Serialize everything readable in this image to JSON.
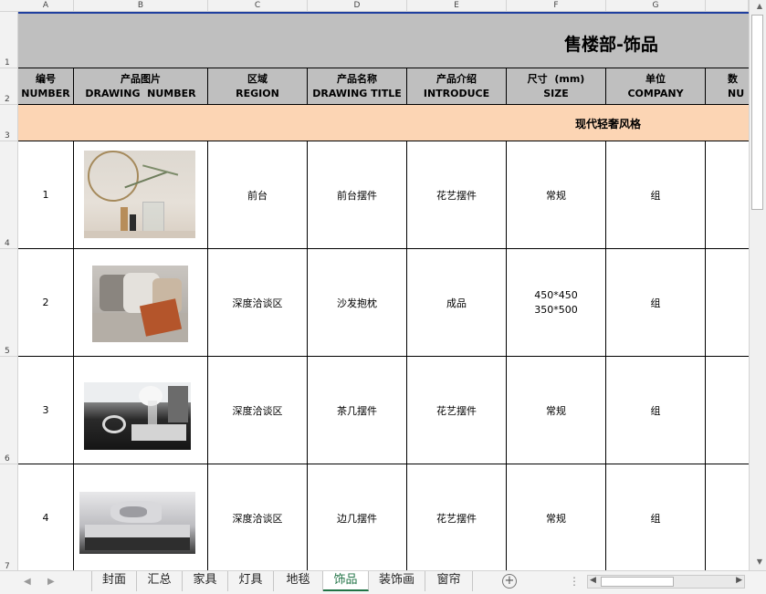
{
  "columns": [
    "A",
    "B",
    "C",
    "D",
    "E",
    "F",
    "G"
  ],
  "rows": [
    "1",
    "2",
    "3",
    "4",
    "5",
    "6",
    "7"
  ],
  "sheet_title": "售楼部-饰品",
  "headers": [
    {
      "cn": "编号",
      "en": "NUMBER"
    },
    {
      "cn": "产品图片",
      "en": "DRAWING  NUMBER"
    },
    {
      "cn": "区域",
      "en": "REGION"
    },
    {
      "cn": "产品名称",
      "en": "DRAWING TITLE"
    },
    {
      "cn": "产品介绍",
      "en": "INTRODUCE"
    },
    {
      "cn": "尺寸  (mm)",
      "en": "SIZE"
    },
    {
      "cn": "单位",
      "en": "COMPANY"
    },
    {
      "cn": "数",
      "en": "NU"
    }
  ],
  "style_label": "现代轻奢风格",
  "items": [
    {
      "number": "1",
      "region": "前台",
      "title": "前台摆件",
      "introduce": "花艺摆件",
      "size": "常规",
      "size2": "",
      "company": "组"
    },
    {
      "number": "2",
      "region": "深度洽谈区",
      "title": "沙发抱枕",
      "introduce": "成品",
      "size": "450*450",
      "size2": "350*500",
      "company": "组"
    },
    {
      "number": "3",
      "region": "深度洽谈区",
      "title": "茶几摆件",
      "introduce": "花艺摆件",
      "size": "常规",
      "size2": "",
      "company": "组"
    },
    {
      "number": "4",
      "region": "深度洽谈区",
      "title": "边几摆件",
      "introduce": "花艺摆件",
      "size": "常规",
      "size2": "",
      "company": "组"
    }
  ],
  "sheet_tabs": [
    "封面",
    "汇总",
    "家具",
    "灯具",
    "地毯",
    "饰品",
    "装饰画",
    "窗帘"
  ],
  "active_tab": "饰品",
  "colors": {
    "title_band": "#bfbfbf",
    "style_band": "#fcd5b4",
    "active_tab": "#217346"
  }
}
